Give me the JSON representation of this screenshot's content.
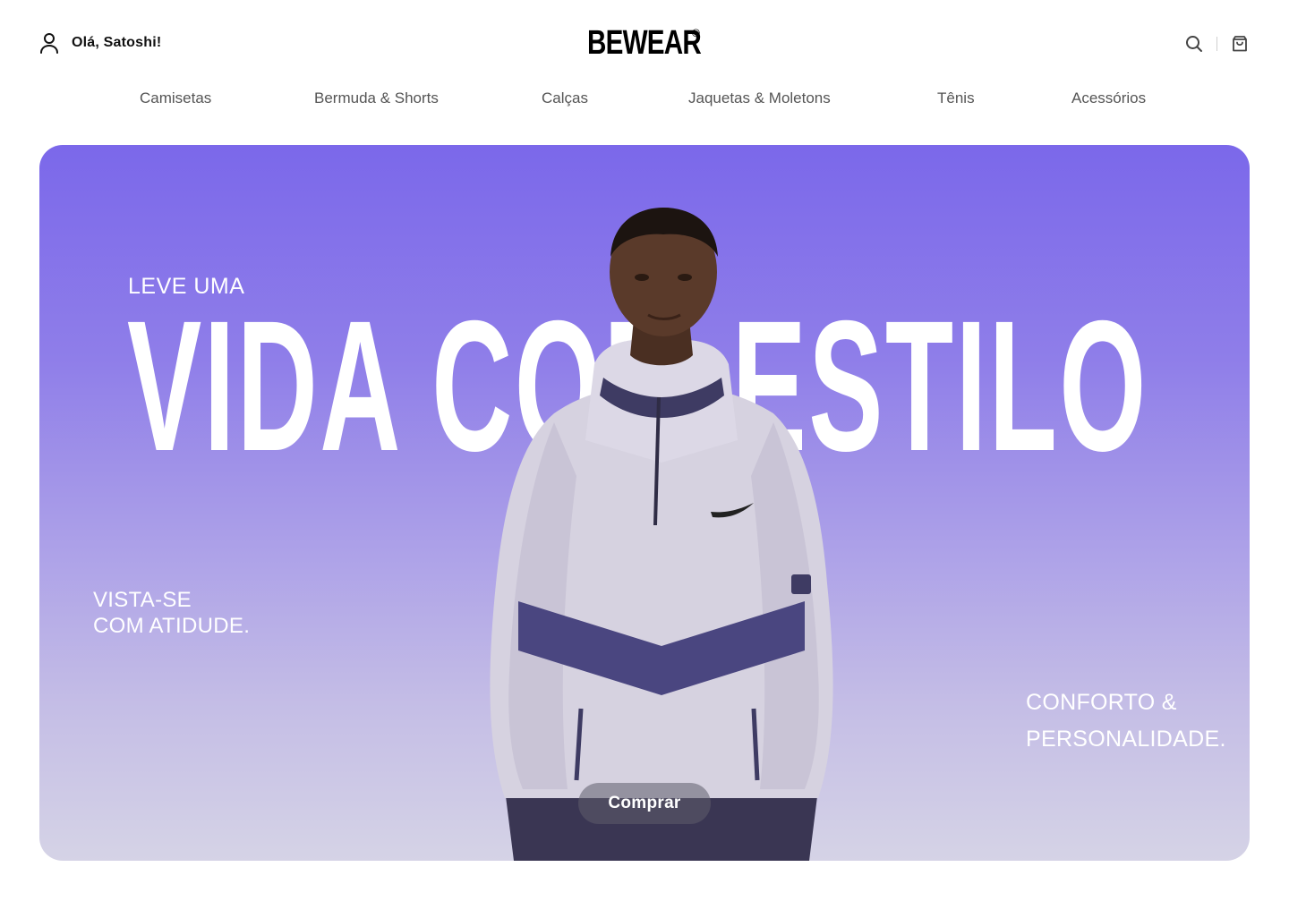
{
  "header": {
    "greeting": "Olá, Satoshi!",
    "logo": "BEWEAR",
    "logo_mark": "®",
    "icons": {
      "account": "user-icon",
      "search": "search-icon",
      "cart": "shopping-bag-icon"
    }
  },
  "nav": {
    "items": [
      {
        "label": "Camisetas"
      },
      {
        "label": "Bermuda & Shorts"
      },
      {
        "label": "Calças"
      },
      {
        "label": "Jaquetas & Moletons"
      },
      {
        "label": "Tênis"
      },
      {
        "label": "Acessórios"
      }
    ]
  },
  "hero": {
    "kicker": "LEVE UMA",
    "headline": "VIDA COM ESTILO",
    "left_tagline": [
      "VISTA-SE",
      "COM ATIDUDE."
    ],
    "right_tagline": [
      "CONFORTO &",
      "PERSONALIDADE."
    ],
    "cta_label": "Comprar",
    "colors": {
      "gradient_top": "#7b68ea",
      "gradient_bottom": "#d5d3e6",
      "text": "#ffffff"
    }
  }
}
